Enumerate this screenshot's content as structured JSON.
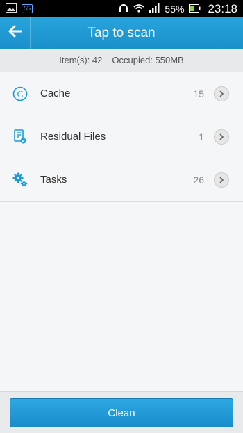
{
  "status_bar": {
    "badge": "55",
    "battery": "55%",
    "time": "23:18",
    "icons": [
      "image-icon",
      "headset-icon",
      "wifi-icon",
      "signal-icon",
      "battery-icon"
    ]
  },
  "header": {
    "title": "Tap to scan",
    "back_icon": "back-arrow-icon"
  },
  "summary": {
    "items": "Item(s): 42",
    "occupied": "Occupied: 550MB"
  },
  "list": [
    {
      "label": "Cache",
      "count": "15",
      "icon": "cache-icon"
    },
    {
      "label": "Residual Files",
      "count": "1",
      "icon": "residual-files-icon"
    },
    {
      "label": "Tasks",
      "count": "26",
      "icon": "tasks-gear-icon"
    }
  ],
  "bottom": {
    "clean_label": "Clean"
  },
  "colors": {
    "accent": "#1f9ad4",
    "background": "#f5f6f8"
  }
}
